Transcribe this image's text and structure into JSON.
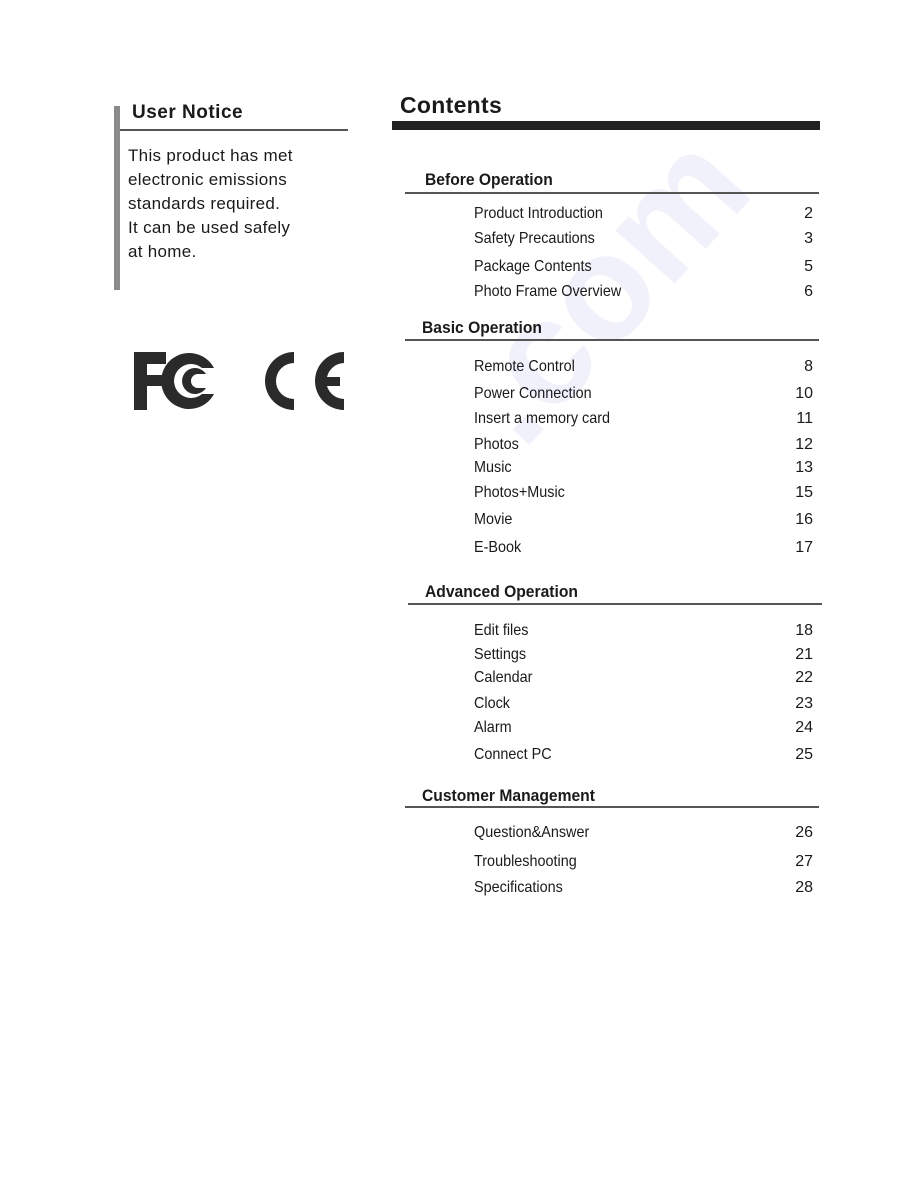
{
  "notice": {
    "title": "User Notice",
    "lines": [
      "This product has met",
      "electronic emissions",
      "standards required.",
      "It can be used safely",
      "at home."
    ]
  },
  "logos": {
    "fc": "FCC mark",
    "ce": "CE mark"
  },
  "contents": {
    "title": "Contents",
    "sections": [
      {
        "title": "Before Operation",
        "items": [
          {
            "label": "Product Introduction",
            "page": "2"
          },
          {
            "label": "Safety Precautions",
            "page": "3"
          },
          {
            "label": "Package Contents",
            "page": "5"
          },
          {
            "label": "Photo Frame Overview",
            "page": "6"
          }
        ]
      },
      {
        "title": "Basic Operation",
        "items": [
          {
            "label": "Remote Control",
            "page": "8"
          },
          {
            "label": "Power Connection",
            "page": "10"
          },
          {
            "label": "Insert a memory card",
            "page": "11"
          },
          {
            "label": "Photos",
            "page": "12"
          },
          {
            "label": "Music",
            "page": "13"
          },
          {
            "label": "Photos+Music",
            "page": "15"
          },
          {
            "label": "Movie",
            "page": "16"
          },
          {
            "label": "E-Book",
            "page": "17"
          }
        ]
      },
      {
        "title": "Advanced Operation",
        "items": [
          {
            "label": "Edit files",
            "page": "18"
          },
          {
            "label": "Settings",
            "page": "21"
          },
          {
            "label": "Calendar",
            "page": "22"
          },
          {
            "label": "Clock",
            "page": "23"
          },
          {
            "label": "Alarm",
            "page": "24"
          },
          {
            "label": "Connect PC",
            "page": "25"
          }
        ]
      },
      {
        "title": "Customer Management",
        "items": [
          {
            "label": "Question&Answer",
            "page": "26"
          },
          {
            "label": "Troubleshooting",
            "page": "27"
          },
          {
            "label": "Specifications",
            "page": "28"
          }
        ]
      }
    ]
  }
}
